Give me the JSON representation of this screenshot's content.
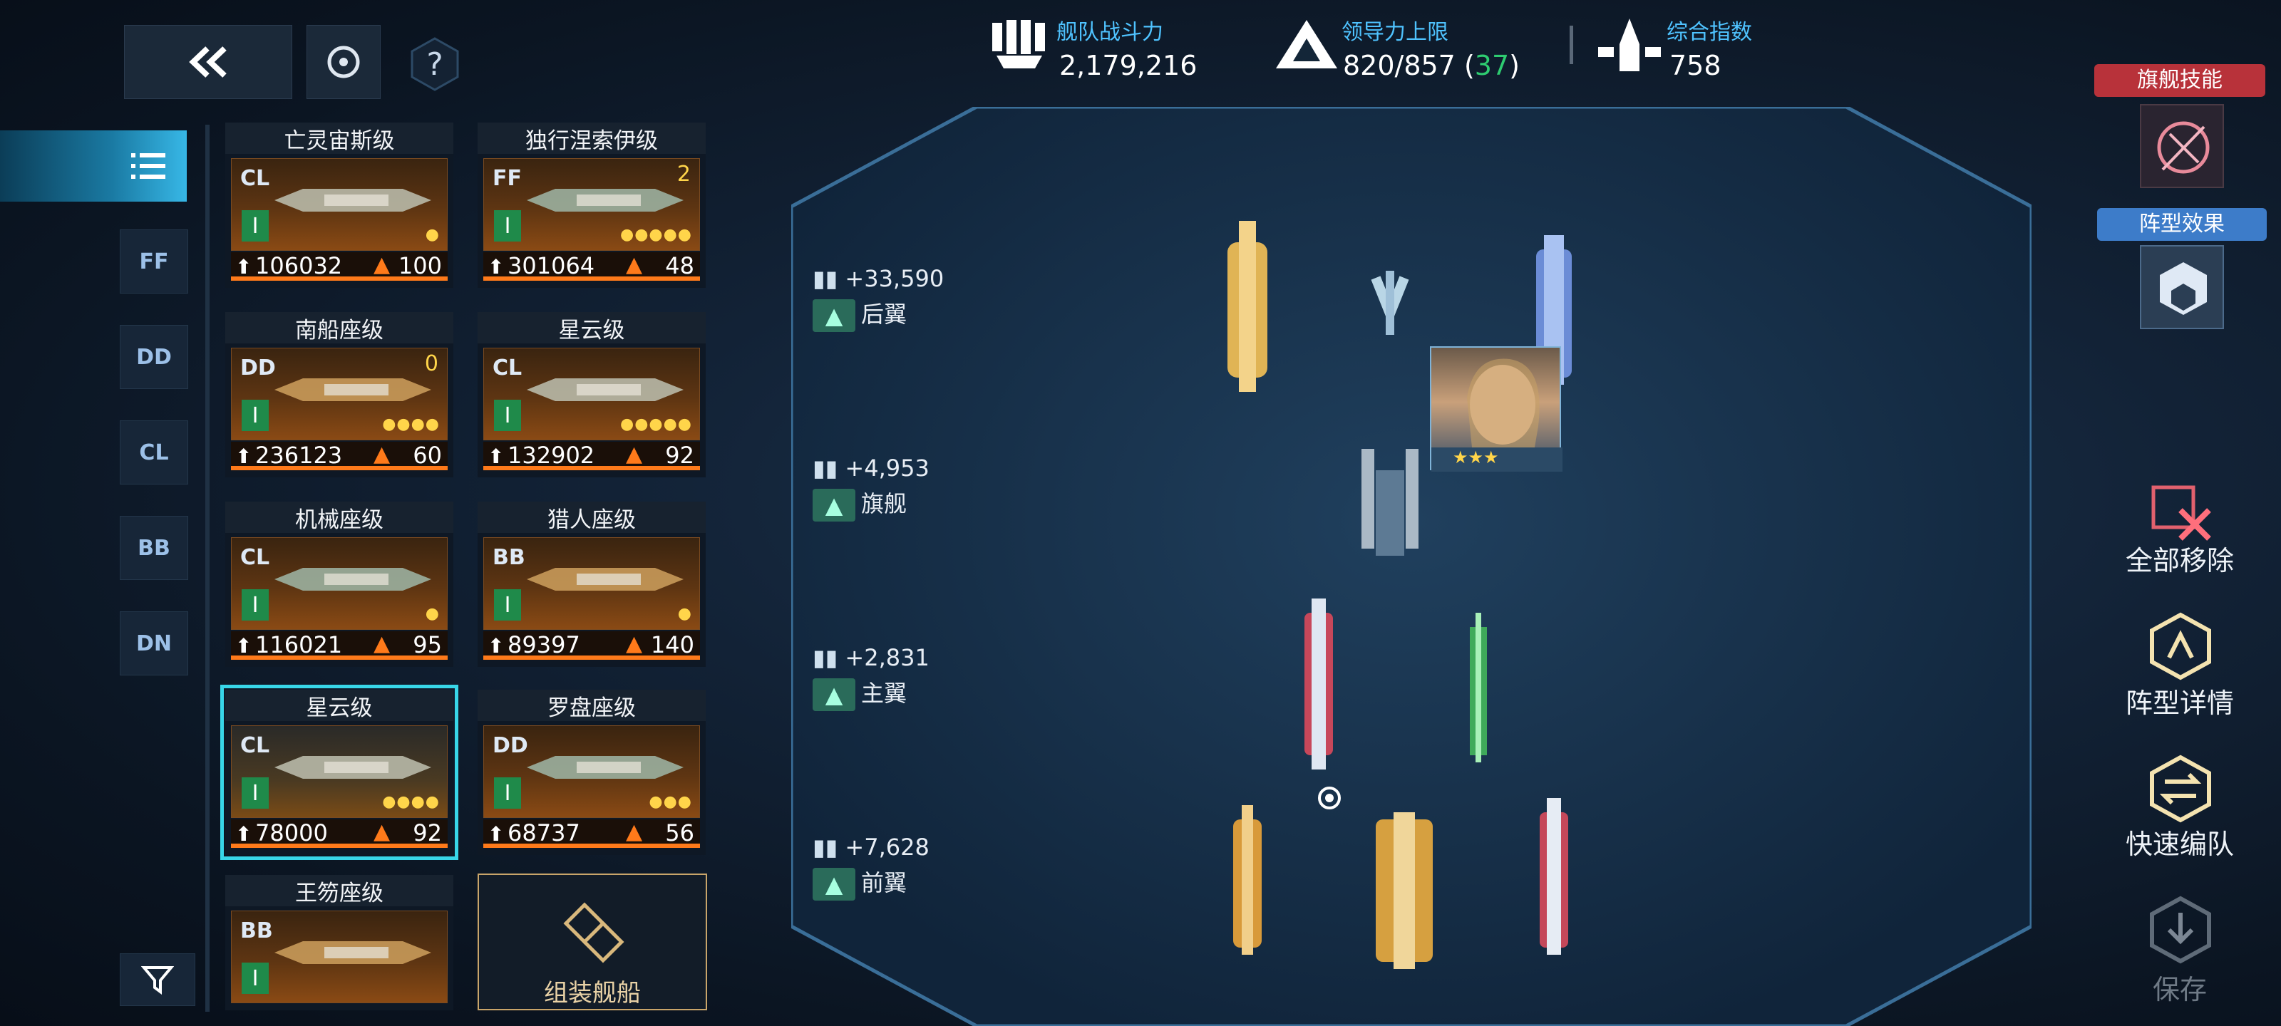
{
  "header": {
    "fleet_power_label": "舰队战斗力",
    "fleet_power_value": "2,179,216",
    "command_label": "领导力上限",
    "command_value": "820/857 (",
    "command_extra": "37",
    "command_close": ")",
    "overall_label": "综合指数",
    "overall_value": "758"
  },
  "top_buttons": {
    "back_icon": "double-chevron-left-icon",
    "target_icon": "target-icon",
    "help_label": "?"
  },
  "side_tabs": [
    "FF",
    "DD",
    "CL",
    "BB",
    "DN"
  ],
  "ships": [
    {
      "name": "亡灵宙斯级",
      "cls": "CL",
      "tier": "I",
      "power": "106032",
      "cost": "100",
      "pips": "●",
      "chip": ""
    },
    {
      "name": "独行涅索伊级",
      "cls": "FF",
      "tier": "I",
      "power": "301064",
      "cost": "48",
      "pips": "●●●●●",
      "chip": "2"
    },
    {
      "name": "南船座级",
      "cls": "DD",
      "tier": "I",
      "power": "236123",
      "cost": "60",
      "pips": "●●●●",
      "chip": "0"
    },
    {
      "name": "星云级",
      "cls": "CL",
      "tier": "I",
      "power": "132902",
      "cost": "92",
      "pips": "●●●●●",
      "chip": ""
    },
    {
      "name": "机械座级",
      "cls": "CL",
      "tier": "I",
      "power": "116021",
      "cost": "95",
      "pips": "●",
      "chip": ""
    },
    {
      "name": "猎人座级",
      "cls": "BB",
      "tier": "I",
      "power": "89397",
      "cost": "140",
      "pips": "●",
      "chip": ""
    },
    {
      "name": "星云级",
      "cls": "CL",
      "tier": "I",
      "power": "78000",
      "cost": "92",
      "pips": "●●●●",
      "chip": ""
    },
    {
      "name": "罗盘座级",
      "cls": "DD",
      "tier": "I",
      "power": "68737",
      "cost": "56",
      "pips": "●●●",
      "chip": ""
    },
    {
      "name": "王笏座级",
      "cls": "BB",
      "tier": "I",
      "power": "",
      "cost": "",
      "pips": "",
      "chip": ""
    }
  ],
  "assemble_label": "组装舰船",
  "formation_rows": [
    {
      "bonus": "+33,590",
      "label": "后翼"
    },
    {
      "bonus": "+4,953",
      "label": "旗舰"
    },
    {
      "bonus": "+2,831",
      "label": "主翼"
    },
    {
      "bonus": "+7,628",
      "label": "前翼"
    }
  ],
  "right_panel": {
    "flagship_skill_label": "旗舰技能",
    "formation_effect_label": "阵型效果",
    "remove_all_label": "全部移除",
    "formation_detail_label": "阵型详情",
    "quick_form_label": "快速编队",
    "save_label": "保存"
  },
  "colors": {
    "accent": "#4fc3ff",
    "orange": "#ff7a1a",
    "gold": "#ffd54a",
    "green": "#2ecc71",
    "red_label": "#b8323a",
    "blue_label": "#3d7cc9"
  }
}
